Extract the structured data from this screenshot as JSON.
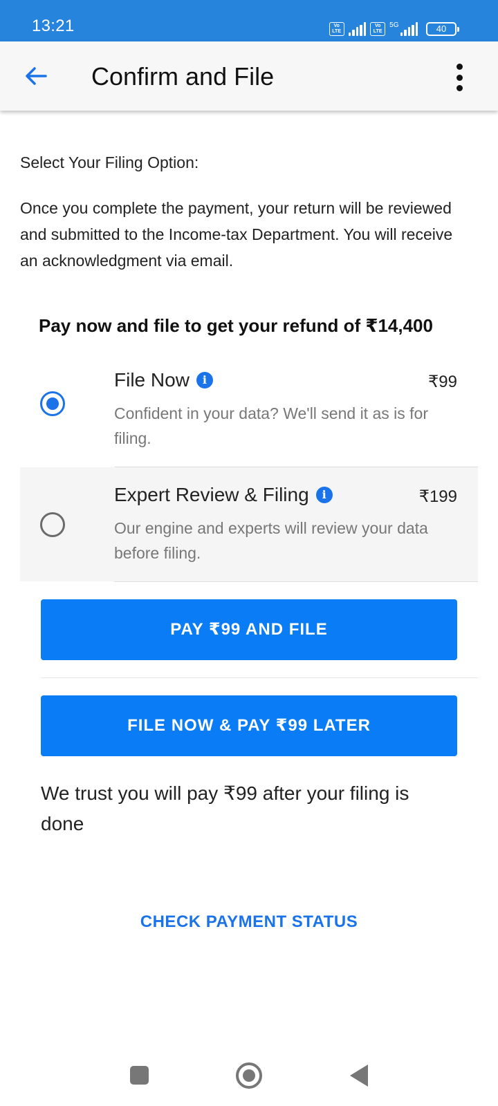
{
  "status_bar": {
    "time": "13:21",
    "volte_label": "Vo LTE",
    "network_label": "5G",
    "battery": "40"
  },
  "app_bar": {
    "title": "Confirm and File",
    "back_icon": "arrow-left-icon",
    "menu_icon": "more-vert-icon"
  },
  "content": {
    "section_label": "Select Your Filing Option:",
    "intro": "Once you complete the payment, your return will be reviewed and submitted to the Income-tax Department. You will receive an acknowledgment via email.",
    "refund_heading": "Pay now and file to get your refund of ₹14,400",
    "options": [
      {
        "title": "File Now",
        "price": "₹99",
        "description": "Confident in your data? We'll send it as is for filing.",
        "selected": true
      },
      {
        "title": "Expert Review & Filing",
        "price": "₹199",
        "description": "Our engine and experts will review your data before filing.",
        "selected": false
      }
    ],
    "info_glyph": "i",
    "pay_button": "PAY ₹99 AND FILE",
    "later_button": "FILE NOW & PAY  ₹99 LATER",
    "trust_text": "We trust you will pay ₹99 after your filing is done",
    "check_status_link": "CHECK PAYMENT STATUS"
  },
  "colors": {
    "status_bar": "#2684dc",
    "primary": "#0a7cf5",
    "accent": "#1a73e8"
  }
}
